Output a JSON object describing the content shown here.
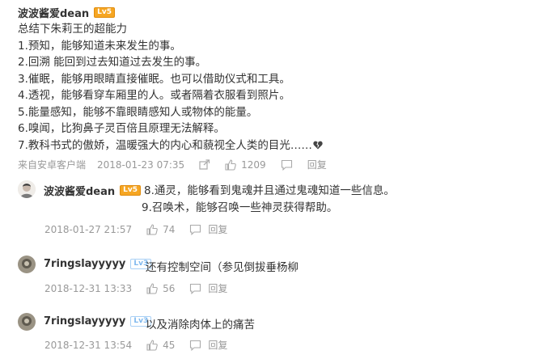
{
  "main_comment": {
    "username": "波波酱爱dean",
    "level": "Lv5",
    "lines": [
      "总结下朱莉王的超能力",
      "1.预知，能够知道未来发生的事。",
      "2.回溯 能回到过去知道过去发生的事。",
      "3.催眠，能够用眼睛直接催眠。也可以借助仪式和工具。",
      "4.透视，能够看穿车厢里的人。或者隔着衣服看到照片。",
      "5.能量感知，能够不靠眼睛感知人或物体的能量。",
      "6.嗅闻，比狗鼻子灵百倍且原理无法解释。",
      "7.教科书式的傲娇，温暖强大的内心和藐视全人类的目光……"
    ],
    "source": "来自安卓客户端",
    "time": "2018-01-23 07:35",
    "likes": "1209",
    "reply_label": "回复"
  },
  "replies": [
    {
      "username": "波波酱爱dean",
      "level": "Lv5",
      "lines": [
        "8.通灵，能够看到鬼魂并且通过鬼魂知道一些信息。",
        "9.召唤术，能够召唤一些神灵获得帮助。"
      ],
      "time": "2018-01-27 21:57",
      "likes": "74",
      "reply_label": "回复"
    },
    {
      "username": "7ringslayyyyy",
      "level": "Lv3",
      "text": "还有控制空间（参见倒拔垂杨柳",
      "time": "2018-12-31 13:33",
      "likes": "56",
      "reply_label": "回复"
    },
    {
      "username": "7ringslayyyyy",
      "level": "Lv3",
      "text": "以及消除肉体上的痛苦",
      "time": "2018-12-31 13:54",
      "likes": "45",
      "reply_label": "回复"
    }
  ]
}
